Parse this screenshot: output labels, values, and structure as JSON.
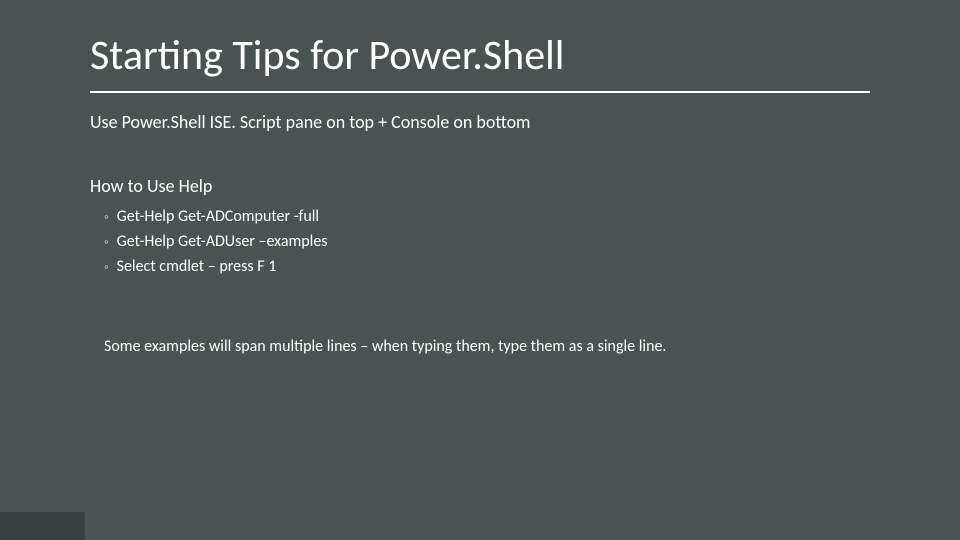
{
  "title": "Starting Tips for Power.Shell",
  "subtitle": "Use Power.Shell ISE. Script pane on top + Console on bottom",
  "section_heading": "How to Use Help",
  "bullets": {
    "0": "Get-Help Get-ADComputer -full",
    "1": "Get-Help Get-ADUser –examples",
    "2": "Select cmdlet – press F 1"
  },
  "note": "Some examples will span multiple lines – when typing them, type them as a single line.",
  "bullet_marker": "◦"
}
